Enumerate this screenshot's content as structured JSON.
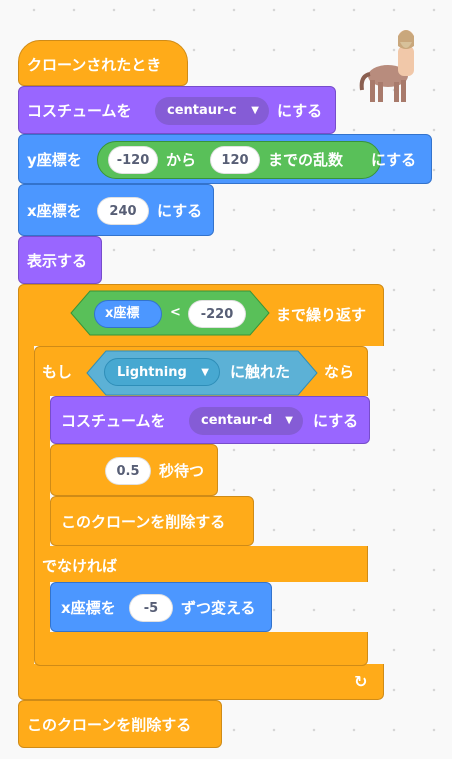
{
  "hat": {
    "label": "クローンされたとき"
  },
  "costume1": {
    "prefix": "コスチュームを",
    "value": "centaur-c",
    "suffix": "にする"
  },
  "sety": {
    "prefix": "y座標を",
    "from_value": "-120",
    "from_label": "から",
    "to_value": "120",
    "to_label": "までの乱数",
    "suffix": "にする"
  },
  "setx": {
    "prefix": "x座標を",
    "value": "240",
    "suffix": "にする"
  },
  "show": {
    "label": "表示する"
  },
  "repeat_until": {
    "xpos_label": "x座標",
    "op": "<",
    "value": "-220",
    "suffix": "まで繰り返す"
  },
  "if_else": {
    "if_label": "もし",
    "sensing_value": "Lightning",
    "sensing_suffix": "に触れた",
    "then_label": "なら",
    "else_label": "でなければ"
  },
  "costume2": {
    "prefix": "コスチュームを",
    "value": "centaur-d",
    "suffix": "にする"
  },
  "wait": {
    "value": "0.5",
    "suffix": "秒待つ"
  },
  "delete_inner": {
    "label": "このクローンを削除する"
  },
  "changex": {
    "prefix": "x座標を",
    "value": "-5",
    "suffix": "ずつ変える"
  },
  "delete_outer": {
    "label": "このクローンを削除する"
  },
  "repeat_arrow": "↻",
  "colors": {
    "control": "#ffab19",
    "looks": "#9966ff",
    "motion": "#4c97ff",
    "operators": "#59c059",
    "sensing": "#5cb1d6"
  }
}
